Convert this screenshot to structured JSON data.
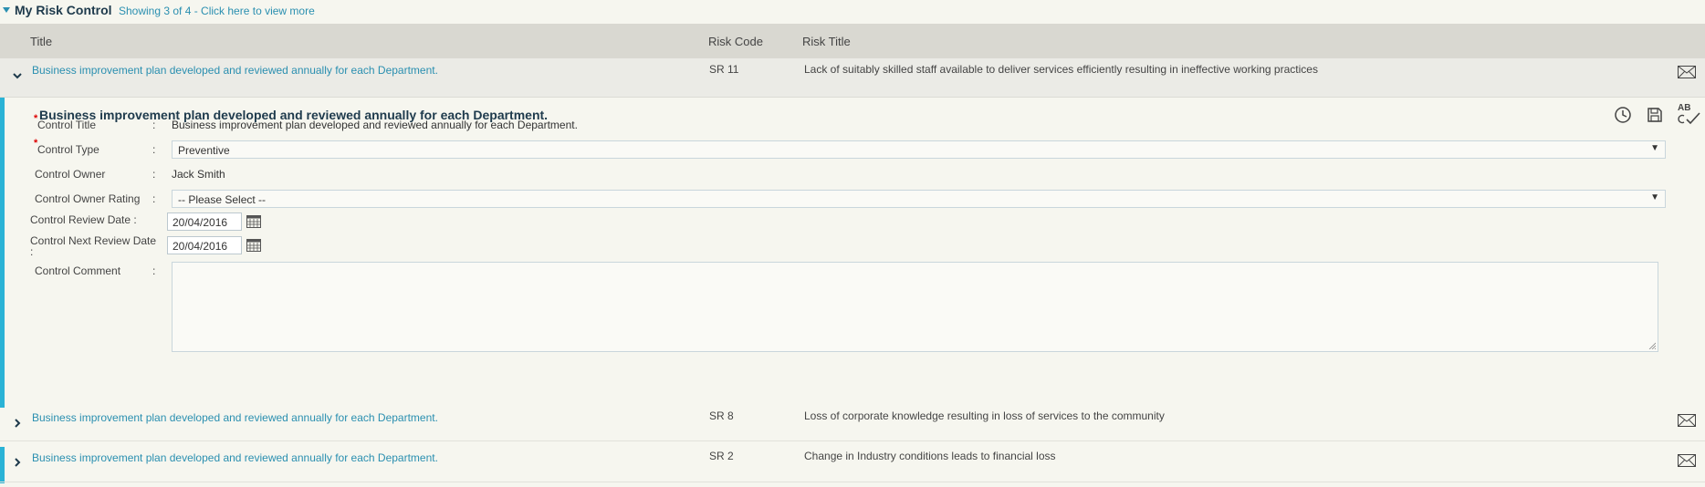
{
  "section": {
    "title": "My Risk Control",
    "showing_link": "Showing 3 of 4 - Click here to view more"
  },
  "columns": {
    "title": "Title",
    "risk_code": "Risk Code",
    "risk_title": "Risk Title"
  },
  "rows": [
    {
      "title": "Business improvement plan developed and reviewed annually for each Department.",
      "risk_code": "SR 11",
      "risk_title": "Lack of suitably skilled staff available to deliver services efficiently resulting in ineffective working practices",
      "expanded": true
    },
    {
      "title": "Business improvement plan developed and reviewed annually for each Department.",
      "risk_code": "SR 8",
      "risk_title": "Loss of corporate knowledge resulting in loss of services to the community",
      "expanded": false
    },
    {
      "title": "Business improvement plan developed and reviewed annually for each Department.",
      "risk_code": "SR 2",
      "risk_title": "Change in Industry conditions leads to financial loss",
      "expanded": false
    }
  ],
  "detail": {
    "heading": "Business improvement plan developed and reviewed annually for each Department.",
    "fields": {
      "control_title": {
        "label": "Control Title",
        "value": "Business improvement plan developed and reviewed annually for each Department."
      },
      "control_type": {
        "label": "Control Type",
        "value": "Preventive"
      },
      "control_owner": {
        "label": "Control Owner",
        "value": "Jack Smith"
      },
      "control_owner_rating": {
        "label": "Control Owner Rating",
        "value": "-- Please Select --"
      },
      "review_date": {
        "label": "Control Review Date :",
        "value": "20/04/2016"
      },
      "next_review_date": {
        "label": "Control Next Review Date",
        "label_suffix": ":",
        "value": "20/04/2016"
      },
      "comment": {
        "label": "Control Comment",
        "value": ""
      }
    },
    "colon": ":",
    "required_mark": "*",
    "spellcheck_label": "AB"
  },
  "colors": {
    "accent": "#2ab3d6",
    "link": "#2a8fb0",
    "header_bg": "#d9d8d1",
    "page_bg": "#f6f6ef"
  },
  "icons": [
    "collapse-triangle-icon",
    "chevron-down-icon",
    "chevron-right-icon",
    "mail-icon",
    "history-clock-icon",
    "save-disk-icon",
    "spellcheck-icon",
    "calendar-icon",
    "resize-grip-icon"
  ]
}
